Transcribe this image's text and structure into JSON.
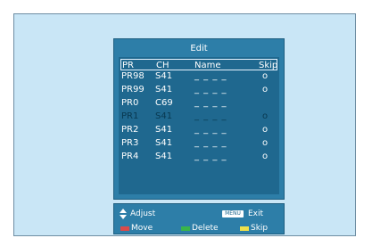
{
  "edit_panel": {
    "title": "Edit",
    "headers": {
      "pr": "PR",
      "ch": "CH",
      "name": "Name",
      "skip": "Skip"
    },
    "rows": [
      {
        "pr": "PR98",
        "ch": "S41",
        "name": "_ _ _ _",
        "skip": "o",
        "selected": false
      },
      {
        "pr": "PR99",
        "ch": "S41",
        "name": "_ _ _ _",
        "skip": "o",
        "selected": false
      },
      {
        "pr": "PR0",
        "ch": "C69",
        "name": "_ _ _ _",
        "skip": "",
        "selected": false
      },
      {
        "pr": "PR1",
        "ch": "S41",
        "name": "_ _ _ _",
        "skip": "o",
        "selected": true
      },
      {
        "pr": "PR2",
        "ch": "S41",
        "name": "_ _ _ _",
        "skip": "o",
        "selected": false
      },
      {
        "pr": "PR3",
        "ch": "S41",
        "name": "_ _ _ _",
        "skip": "o",
        "selected": false
      },
      {
        "pr": "PR4",
        "ch": "S41",
        "name": "_ _ _ _",
        "skip": "o",
        "selected": false
      }
    ]
  },
  "footer": {
    "adjust": "Adjust",
    "menu_key": "MENU",
    "exit": "Exit",
    "move": "Move",
    "delete": "Delete",
    "skip": "Skip",
    "adjust_icon": "up-down-arrow-icon"
  },
  "colors": {
    "screen_background": "#c9e6f6",
    "panel_background": "#2d7ea8",
    "inner_background": "#1f688f",
    "move_key": "#d94a4a",
    "delete_key": "#39b54a",
    "skip_key": "#f0e04a"
  }
}
